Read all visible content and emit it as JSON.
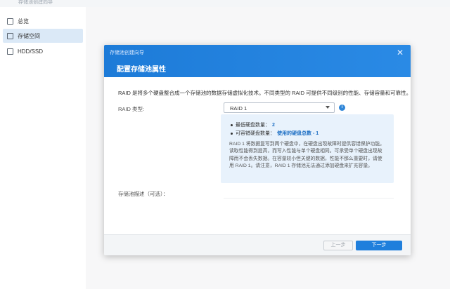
{
  "app": {
    "title": "存储池创建向导"
  },
  "sidebar": {
    "items": [
      {
        "label": "总览",
        "icon": "overview-icon"
      },
      {
        "label": "存储空间",
        "icon": "storage-icon"
      },
      {
        "label": "HDD/SSD",
        "icon": "disk-icon"
      }
    ]
  },
  "dialog": {
    "title": "存储池创建向导",
    "heading": "配置存储池属性",
    "description": "RAID 是将多个硬盘整合成一个存储池的数据存储虚拟化技术。不同类型的 RAID 可提供不同级别的性能、存储容量和可靠性。",
    "raid_type_label": "RAID 类型:",
    "raid_type_value": "RAID 1",
    "info_box": {
      "min_disks_label": "最低硬盘数量：",
      "min_disks_value": "2",
      "fault_tolerance_label": "可容错硬盘数量：",
      "fault_tolerance_value": "使用的硬盘总数 - 1",
      "paragraph": "RAID 1 将数据复写到两个硬盘中，在硬盘出现故障时提供容错保护功能。读取性能得到提高，而写入性能与单个硬盘相同。可承受单个硬盘出现故障而不会丢失数据。在容量较小但关键的数据，性能不那么重要时，请使用 RAID 1。请注意，RAID 1 存储池无法通过添加硬盘来扩充容量。"
    },
    "description_field_label": "存储池描述（可选）：",
    "buttons": {
      "prev": "上一步",
      "next": "下一步"
    }
  },
  "colors": {
    "accent": "#1f7fdc",
    "header": "#1d7bd8",
    "info_bg": "#e8f2fc"
  }
}
